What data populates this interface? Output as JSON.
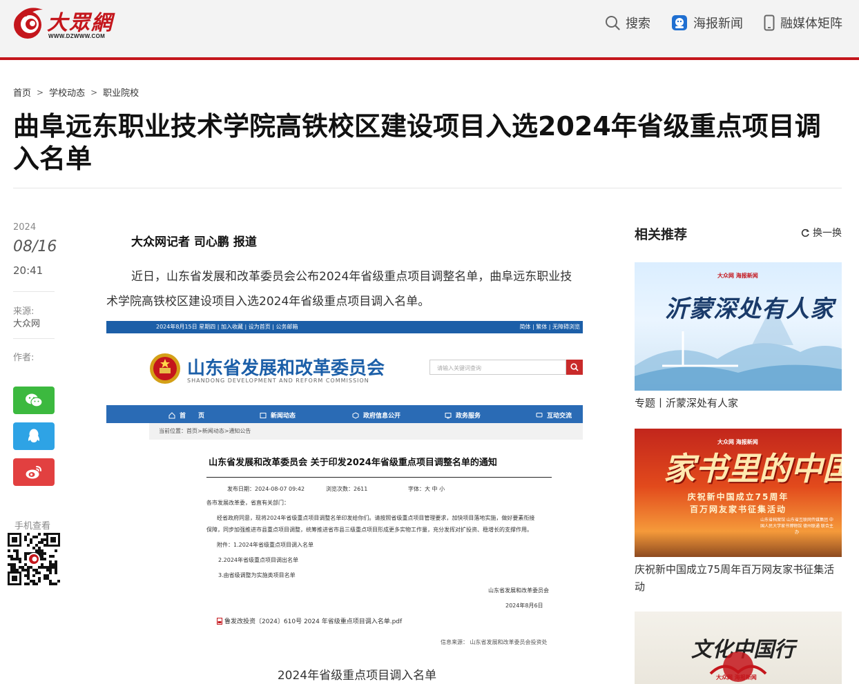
{
  "header": {
    "brand": "大眾網",
    "url": "WWW.DZWWW.COM",
    "nav": [
      {
        "label": "搜索"
      },
      {
        "label": "海报新闻"
      },
      {
        "label": "融媒体矩阵"
      }
    ]
  },
  "breadcrumb": [
    "首页",
    "学校动态",
    "职业院校"
  ],
  "breadcrumb_sep": ">",
  "article": {
    "title": "曲阜远东职业技术学院高铁校区建设项目入选2024年省级重点项目调入名单",
    "year": "2024",
    "date": "08/16",
    "time": "20:41",
    "source_label": "来源:",
    "source": "大众网",
    "author_label": "作者:",
    "byline": "大众网记者 司心鹏 报道",
    "paragraph": "近日，山东省发展和改革委员会公布2024年省级重点项目调整名单，曲阜远东职业技术学院高铁校区建设项目入选2024年省级重点项目调入名单。",
    "caption": "2024年省级重点项目调入名单",
    "mobile_label": "手机查看"
  },
  "screenshot": {
    "topstrip_left": "2024年8月15日 星期四 | 加入收藏 | 设为首页 | 公务邮箱",
    "topstrip_right": "简体 | 繁体 | 无障碍浏览",
    "org_name": "山东省发展和改革委员会",
    "org_en": "SHANDONG DEVELOPMENT AND REFORM COMMISSION",
    "search_placeholder": "请输入关键词查询",
    "nav": [
      "首　　页",
      "新闻动态",
      "政府信息公开",
      "政务服务",
      "互动交流"
    ],
    "crumb": "当前位置：首页>新闻动态>通知公告",
    "doc_title": "山东省发展和改革委员会 关于印发2024年省级重点项目调整名单的通知",
    "info_date": "发布日期：2024-08-07 09:42",
    "info_views": "浏览次数：2611",
    "info_font": "字体：大 中 小",
    "lines": [
      "各市发展改革委，省直有关部门：",
      "经省政府同意，现将2024年省级重点项目调整名单印发给你们。请按照省级重点项目管理要求，加快项目落地实施，做好要素衔接",
      "保障，同步加强推进市县重点项目调整，统筹推进省市县三级重点项目形成更多实物工作量，充分发挥对扩投资、稳增长的支撑作用。",
      "附件：1.2024年省级重点项目调入名单",
      "2.2024年省级重点项目调出名单",
      "3.由省级调整为实施类项目名单",
      "山东省发展和改革委员会",
      "2024年8月6日"
    ],
    "pdf": "鲁发改投资〔2024〕610号 2024 年省级重点项目调入名单.pdf",
    "footnote": "信息来源：  山东省发展和改革委员会投资处"
  },
  "sidebar": {
    "title": "相关推荐",
    "refresh_label": "换一换",
    "cards": [
      {
        "caption": "专题丨沂蒙深处有人家",
        "image_text": "沂蒙深处有人家"
      },
      {
        "caption": "庆祝新中国成立75周年百万网友家书征集活动",
        "image_text": "家书里的中国",
        "sub1": "庆祝新中国成立75周年",
        "sub2": "百万网友家书征集活动",
        "small": "山东省档案馆 山东省互联网传媒集团 中国人民大学家书博物馆 德州联通 联合主办"
      },
      {
        "caption": "",
        "image_text": "文化中国行"
      }
    ],
    "card_logo": "大众网 海报新闻"
  },
  "colors": {
    "brand_red": "#c4161c",
    "gov_blue": "#1c5fa8",
    "wechat": "#3cb93f",
    "qq": "#2ea3e5",
    "weibo": "#e24040"
  }
}
